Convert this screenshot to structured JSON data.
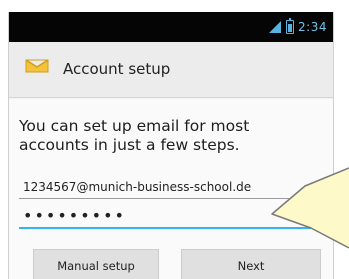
{
  "status_bar": {
    "time": "2:34",
    "icons": [
      "signal-icon",
      "battery-icon"
    ],
    "accent_color": "#33b5e5"
  },
  "action_bar": {
    "title": "Account setup",
    "icon": "email-envelope-icon"
  },
  "form": {
    "intro_text": "You can set up email for most accounts in just a few steps.",
    "email_value": "1234567@munich-business-school.de",
    "password_value": "•••••••••"
  },
  "buttons": {
    "manual_setup_label": "Manual setup",
    "next_label": "Next"
  },
  "overlay": {
    "shape": "callout-pointer",
    "fill_color": "#fdf9c8"
  }
}
